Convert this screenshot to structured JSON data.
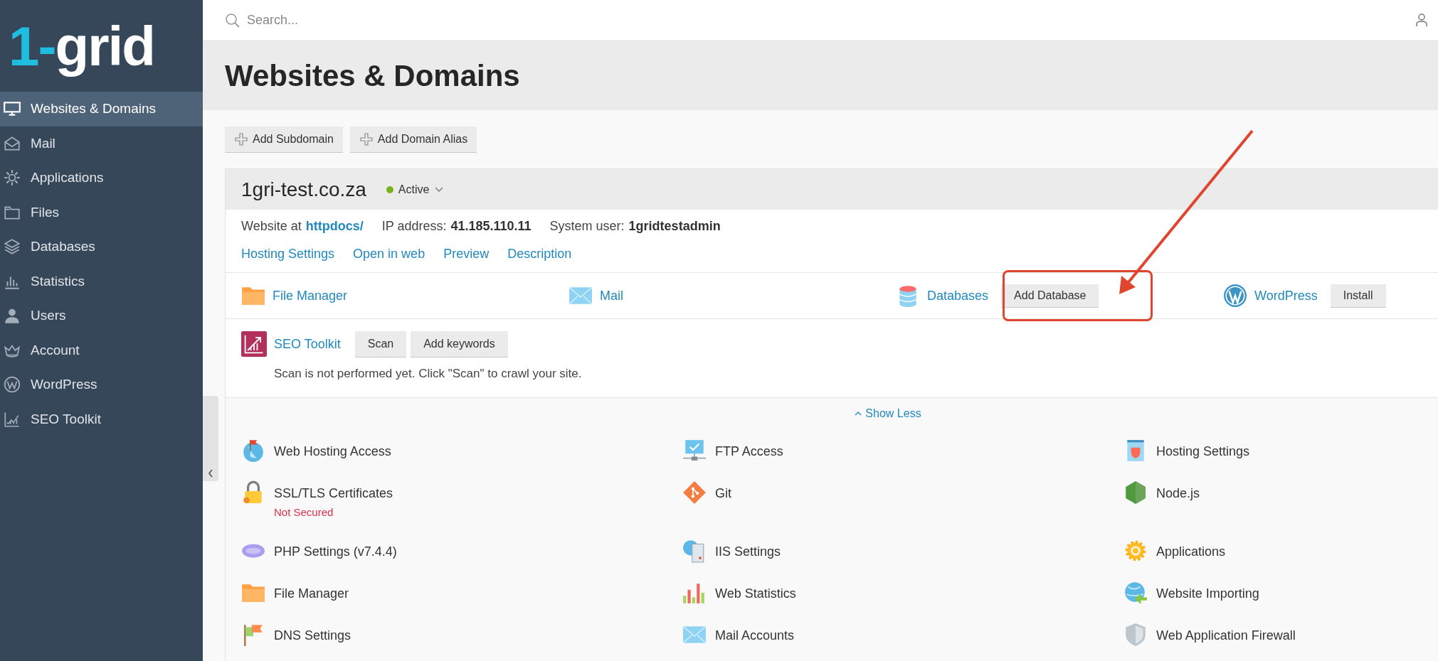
{
  "logo": {
    "accent": "1-",
    "name": "grid"
  },
  "sidebar": {
    "items": [
      {
        "label": "Websites & Domains",
        "selected": true
      },
      {
        "label": "Mail",
        "selected": false
      },
      {
        "label": "Applications",
        "selected": false
      },
      {
        "label": "Files",
        "selected": false
      },
      {
        "label": "Databases",
        "selected": false
      },
      {
        "label": "Statistics",
        "selected": false
      },
      {
        "label": "Users",
        "selected": false
      },
      {
        "label": "Account",
        "selected": false
      },
      {
        "label": "WordPress",
        "selected": false
      },
      {
        "label": "SEO Toolkit",
        "selected": false
      }
    ]
  },
  "search": {
    "placeholder": "Search..."
  },
  "page_title": "Websites & Domains",
  "toolbar_buttons": [
    "Add Subdomain",
    "Add Domain Alias"
  ],
  "domain": {
    "name": "1gri-test.co.za",
    "status": "Active",
    "info": [
      {
        "label": "Website at",
        "value": "httpdocs/",
        "kind": "link"
      },
      {
        "label": "IP address:",
        "value": "41.185.110.11",
        "kind": "text"
      },
      {
        "label": "System user:",
        "value": "1gridtestadmin",
        "kind": "text"
      }
    ],
    "links": [
      "Hosting Settings",
      "Open in web",
      "Preview",
      "Description"
    ],
    "tools": [
      {
        "label": "File Manager"
      },
      {
        "label": "Mail"
      },
      {
        "label": "Databases",
        "button": "Add Database"
      },
      {
        "label": "WordPress",
        "button": "Install"
      }
    ],
    "seo": {
      "label": "SEO Toolkit",
      "buttons": [
        "Scan",
        "Add keywords"
      ],
      "note": "Scan is not performed yet. Click \"Scan\" to crawl your site."
    },
    "show_less": "Show Less",
    "items": [
      {
        "label": "Web Hosting Access"
      },
      {
        "label": "FTP Access"
      },
      {
        "label": "Hosting Settings"
      },
      {
        "label": "SSL/TLS Certificates",
        "note": "Not Secured"
      },
      {
        "label": "Git"
      },
      {
        "label": "Node.js"
      },
      {
        "label": "PHP Settings (v7.4.4)"
      },
      {
        "label": "IIS Settings"
      },
      {
        "label": "Applications"
      },
      {
        "label": "File Manager"
      },
      {
        "label": "Web Statistics"
      },
      {
        "label": "Website Importing"
      },
      {
        "label": "DNS Settings"
      },
      {
        "label": "Mail Accounts"
      },
      {
        "label": "Web Application Firewall"
      }
    ]
  }
}
